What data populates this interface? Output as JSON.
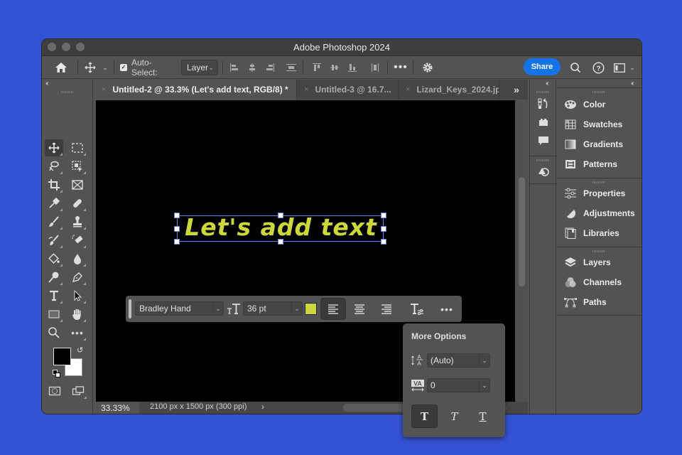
{
  "window": {
    "title": "Adobe Photoshop 2024"
  },
  "options_bar": {
    "auto_select_label": "Auto-Select:",
    "auto_select_checked": true,
    "auto_select_target": "Layer",
    "share_label": "Share"
  },
  "tabs": [
    {
      "label": "Untitled-2 @ 33.3% (Let's add text, RGB/8) *",
      "active": true
    },
    {
      "label": "Untitled-3 @ 16.7...",
      "active": false
    },
    {
      "label": "Lizard_Keys_2024.jpg",
      "active": false
    }
  ],
  "tools": [
    "move-tool",
    "marquee-tool",
    "lasso-tool",
    "object-selection-tool",
    "crop-tool",
    "frame-tool",
    "eyedropper-tool",
    "healing-brush-tool",
    "brush-tool",
    "clone-stamp-tool",
    "history-brush-tool",
    "eraser-tool",
    "paint-bucket-tool",
    "blur-tool",
    "dodge-tool",
    "pen-tool",
    "type-tool",
    "path-selection-tool",
    "rectangle-tool",
    "hand-tool",
    "zoom-tool",
    "edit-toolbar"
  ],
  "colors": {
    "foreground": "#000000",
    "background": "#ffffff",
    "text_color": "#cdd63a",
    "accent": "#1473e6"
  },
  "canvas": {
    "text": "Let's add text"
  },
  "context_bar": {
    "font_family": "Bradley Hand",
    "font_size": "36 pt",
    "text_color": "#cdd63a",
    "alignment": "left"
  },
  "more_options": {
    "title": "More Options",
    "leading": "(Auto)",
    "tracking": "0",
    "styles": [
      "regular",
      "italic",
      "underline"
    ],
    "active_style": "regular"
  },
  "status": {
    "zoom": "33.33%",
    "doc_info": "2100 px x 1500 px (300 ppi)"
  },
  "panels": {
    "group1": [
      "Color",
      "Swatches",
      "Gradients",
      "Patterns"
    ],
    "group2": [
      "Properties",
      "Adjustments",
      "Libraries"
    ],
    "group3": [
      "Layers",
      "Channels",
      "Paths"
    ]
  }
}
